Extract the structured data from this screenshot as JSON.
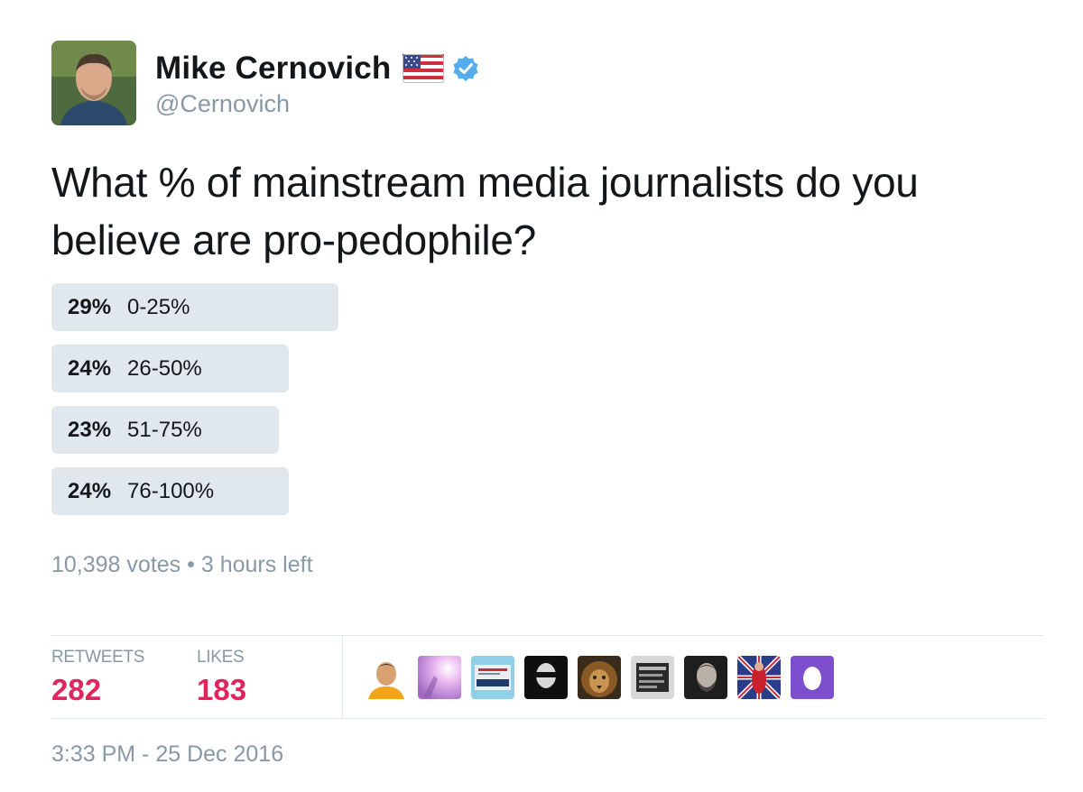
{
  "author": {
    "display_name": "Mike Cernovich",
    "handle": "@Cernovich",
    "verified": true
  },
  "tweet": {
    "text_line1": "What % of mainstream media journalists do you",
    "text_line2": "believe are pro-pedophile?"
  },
  "poll": {
    "options": [
      {
        "percent": "29%",
        "label": "0-25%",
        "value": 29
      },
      {
        "percent": "24%",
        "label": "26-50%",
        "value": 24
      },
      {
        "percent": "23%",
        "label": "51-75%",
        "value": 23
      },
      {
        "percent": "24%",
        "label": "76-100%",
        "value": 24
      }
    ],
    "votes": "10,398 votes",
    "separator": "•",
    "time_left": "3 hours left"
  },
  "stats": {
    "retweets_label": "RETWEETS",
    "retweets_value": "282",
    "likes_label": "LIKES",
    "likes_value": "183"
  },
  "timestamp": "3:33 PM - 25 Dec 2016",
  "colors": {
    "poll_bar": "#e1e8ed",
    "likes_accent": "#e0245e",
    "muted_text": "#8899a6",
    "verified_blue": "#1da1f2"
  }
}
